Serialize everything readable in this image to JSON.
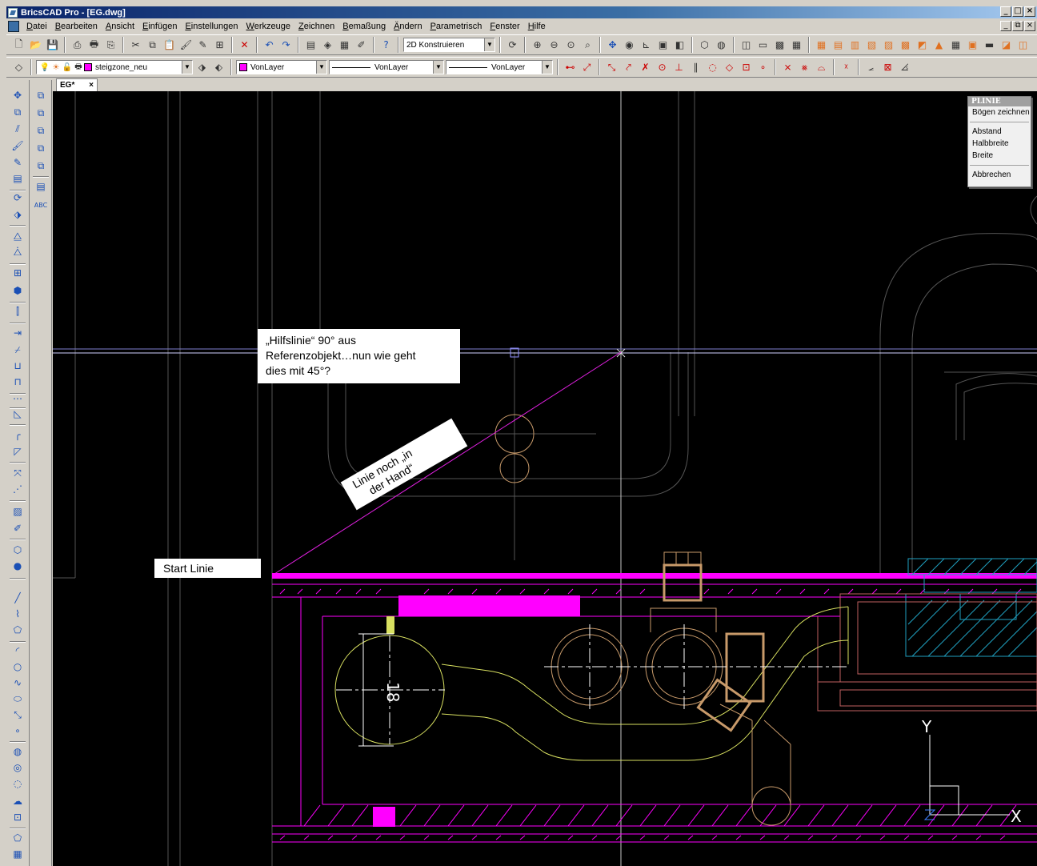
{
  "window": {
    "title": "BricsCAD Pro - [EG.dwg]",
    "buttons": [
      "_",
      "□",
      "×"
    ]
  },
  "menubar": {
    "items": [
      "Datei",
      "Bearbeiten",
      "Ansicht",
      "Einfügen",
      "Einstellungen",
      "Werkzeuge",
      "Zeichnen",
      "Bemaßung",
      "Ändern",
      "Parametrisch",
      "Fenster",
      "Hilfe"
    ],
    "mdi_buttons": [
      "_",
      "⧉",
      "×"
    ]
  },
  "toolbar1": {
    "workspace_combo": "2D Konstruieren"
  },
  "toolbar2": {
    "layer_combo": "steigzone_neu",
    "color_combo": "VonLayer",
    "linetype_combo": "VonLayer",
    "lineweight_combo": "VonLayer"
  },
  "tabs": [
    {
      "label": "EG*",
      "close": "×"
    }
  ],
  "context_menu": {
    "header": "PLINIE",
    "group1": [
      "Bögen zeichnen"
    ],
    "group2": [
      "Abstand",
      "Halbbreite",
      "Breite"
    ],
    "group3": [
      "Abbrechen"
    ]
  },
  "annotations": {
    "hilfslinie": {
      "line1": "„Hilfslinie“ 90° aus",
      "line2": "Referenzobjekt…nun wie geht",
      "line3": "dies mit 45°?"
    },
    "start": "Start Linie",
    "hand": {
      "line1": "Linie noch „in",
      "line2": "der Hand“"
    }
  },
  "drawing": {
    "dimension_text": "18",
    "ucs_y": "Y",
    "ucs_x": "X"
  },
  "colors": {
    "magenta": "#ff00ff",
    "canvas_bg": "#000000",
    "tan": "#c89a6a",
    "yellow_green": "#d8e060",
    "cyan": "#20a0c0"
  },
  "icons": {
    "toolbar1": [
      "new-icon",
      "open-icon",
      "save-icon",
      "print-preview-icon",
      "print-icon",
      "publish-icon",
      "cut-icon",
      "copy-icon",
      "paste-icon",
      "match-properties-icon",
      "eyedropper-icon",
      "block-icon",
      "delete-icon",
      "undo-icon",
      "redo-icon",
      "properties-icon",
      "layer-icon",
      "design-center-icon",
      "attribute-icon",
      "help-icon"
    ],
    "left_tools": [
      "move-icon",
      "copy-objects-icon",
      "rotate-icon",
      "scale-icon",
      "stretch-icon",
      "mirror-icon",
      "array-icon",
      "offset-icon",
      "trim-icon",
      "extend-icon",
      "break-icon",
      "fillet-icon",
      "chamfer-icon",
      "explode-icon"
    ]
  }
}
